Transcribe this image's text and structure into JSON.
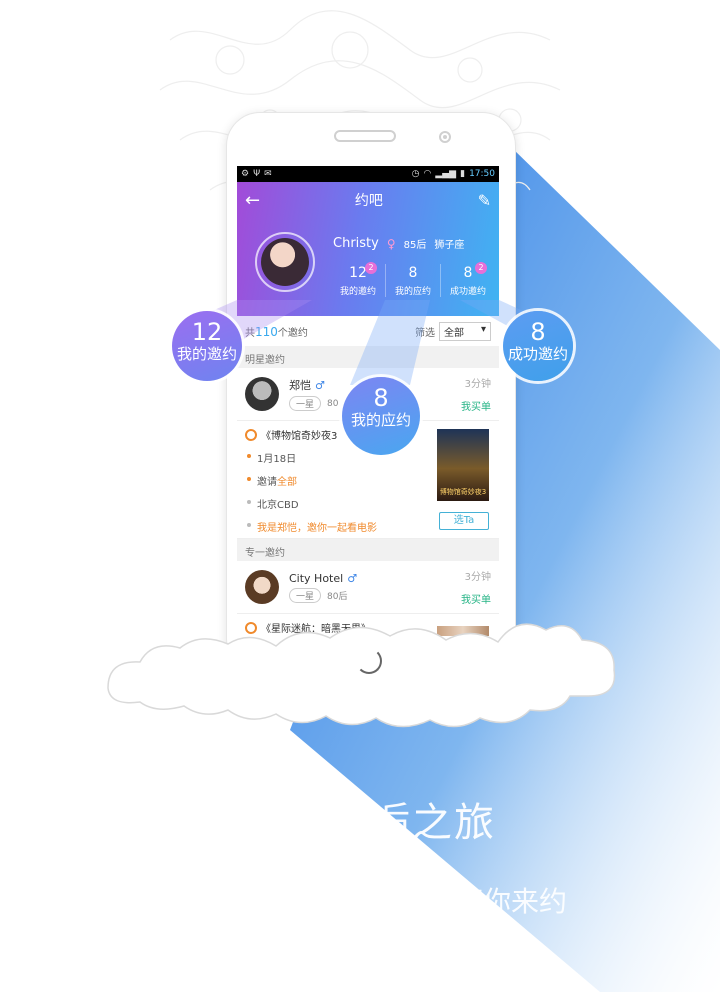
{
  "statusbar": {
    "time": "17:50"
  },
  "header": {
    "title": "约吧"
  },
  "profile": {
    "name": "Christy",
    "age": "85后",
    "sign": "狮子座",
    "stats": [
      {
        "value": "12",
        "label": "我的邀约",
        "badge": "2"
      },
      {
        "value": "8",
        "label": "我的应约",
        "badge": ""
      },
      {
        "value": "8",
        "label": "成功邀约",
        "badge": "2"
      }
    ]
  },
  "listbar": {
    "prefix": "共",
    "count": "110",
    "suffix": "个邀约",
    "filter_label": "筛选",
    "filter_value": "全部"
  },
  "sections": {
    "star": "明星邀约",
    "exclusive": "专一邀约"
  },
  "cards": [
    {
      "name": "郑恺",
      "tag": "一星",
      "age": "80",
      "time": "3分钟",
      "action": "我买单"
    },
    {
      "name": "City Hotel",
      "tag": "一星",
      "age": "80后",
      "time": "3分钟",
      "action": "我买单"
    }
  ],
  "event": {
    "title": "《博物馆奇妙夜3",
    "date": "1月18日",
    "invite_prefix": "邀请",
    "invite_value": "全部",
    "location": "北京CBD",
    "message": "我是郑恺，邀你一起看电影",
    "poster_label": "博物馆奇妙夜3",
    "select_label": "选Ta"
  },
  "peek": {
    "title": "《星际迷航：暗黑无界》"
  },
  "bubbles": [
    {
      "value": "12",
      "label": "我的邀约"
    },
    {
      "value": "8",
      "label": "我的应约"
    },
    {
      "value": "8",
      "label": "成功邀约"
    }
  ],
  "slogan": {
    "line1": "逅之旅",
    "line2": "等你来约"
  },
  "colors": {
    "accent_blue": "#39a9ee",
    "accent_orange": "#f08a2c",
    "accent_green": "#26b486",
    "beam_blue": "#2f7de6"
  }
}
